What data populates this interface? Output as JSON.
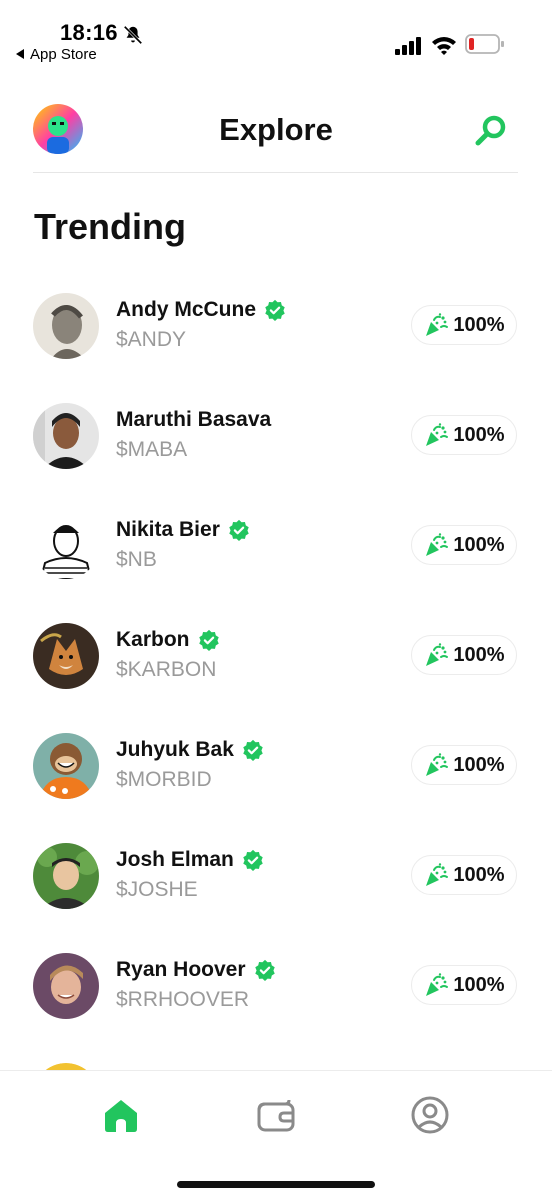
{
  "status_bar": {
    "time": "18:16",
    "back_app": "App Store",
    "icons": [
      "bell-slash-icon",
      "signal-icon",
      "wifi-icon",
      "battery-low-icon"
    ]
  },
  "header": {
    "title": "Explore",
    "avatar": "user-avatar",
    "search_icon": "search-icon"
  },
  "section": {
    "title": "Trending"
  },
  "colors": {
    "accent": "#22c55e",
    "text": "#111111",
    "muted": "#9a9a9a",
    "divider": "#e6e6e6"
  },
  "trending": [
    {
      "name": "Andy McCune",
      "ticker": "$ANDY",
      "verified": true,
      "change": "100%"
    },
    {
      "name": "Maruthi Basava",
      "ticker": "$MABA",
      "verified": false,
      "change": "100%"
    },
    {
      "name": "Nikita Bier",
      "ticker": "$NB",
      "verified": true,
      "change": "100%"
    },
    {
      "name": "Karbon",
      "ticker": "$KARBON",
      "verified": true,
      "change": "100%"
    },
    {
      "name": "Juhyuk Bak",
      "ticker": "$MORBID",
      "verified": true,
      "change": "100%"
    },
    {
      "name": "Josh Elman",
      "ticker": "$JOSHE",
      "verified": true,
      "change": "100%"
    },
    {
      "name": "Ryan Hoover",
      "ticker": "$RRHOOVER",
      "verified": true,
      "change": "100%"
    }
  ],
  "tabbar": {
    "items": [
      {
        "icon": "home-icon",
        "active": true
      },
      {
        "icon": "wallet-icon",
        "active": false
      },
      {
        "icon": "profile-icon",
        "active": false
      }
    ]
  }
}
